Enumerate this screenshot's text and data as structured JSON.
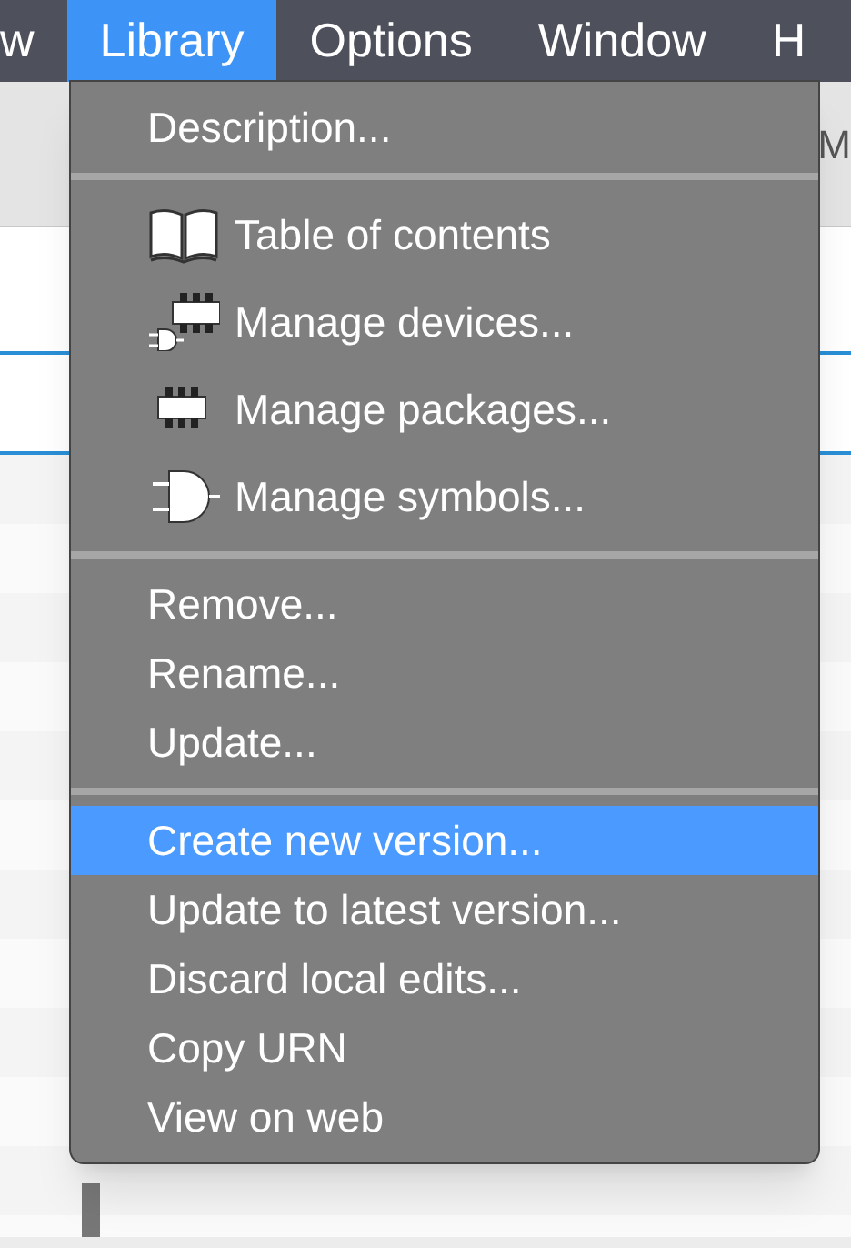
{
  "menu_bar": [
    {
      "label": "w",
      "selected": false
    },
    {
      "label": "Library",
      "selected": true
    },
    {
      "label": "Options",
      "selected": false
    },
    {
      "label": "Window",
      "selected": false
    },
    {
      "label": "H",
      "selected": false
    }
  ],
  "background": {
    "title_fragment": "M"
  },
  "library_menu": {
    "groups": [
      [
        {
          "label": "Description...",
          "kind": "plain",
          "selected": false
        }
      ],
      [
        {
          "label": "Table of contents",
          "kind": "icon",
          "selected": false
        },
        {
          "label": "Manage devices...",
          "kind": "icon",
          "selected": false
        },
        {
          "label": "Manage packages...",
          "kind": "icon",
          "selected": false
        },
        {
          "label": "Manage symbols...",
          "kind": "icon",
          "selected": false
        }
      ],
      [
        {
          "label": "Remove...",
          "kind": "plain",
          "selected": false
        },
        {
          "label": "Rename...",
          "kind": "plain",
          "selected": false
        },
        {
          "label": "Update...",
          "kind": "plain",
          "selected": false
        }
      ],
      [
        {
          "label": "Create new version...",
          "kind": "plain",
          "selected": true
        },
        {
          "label": "Update to latest version...",
          "kind": "plain",
          "selected": false
        },
        {
          "label": "Discard local edits...",
          "kind": "plain",
          "selected": false
        },
        {
          "label": "Copy URN",
          "kind": "plain",
          "selected": false
        },
        {
          "label": "View on web",
          "kind": "plain",
          "selected": false
        }
      ]
    ]
  }
}
